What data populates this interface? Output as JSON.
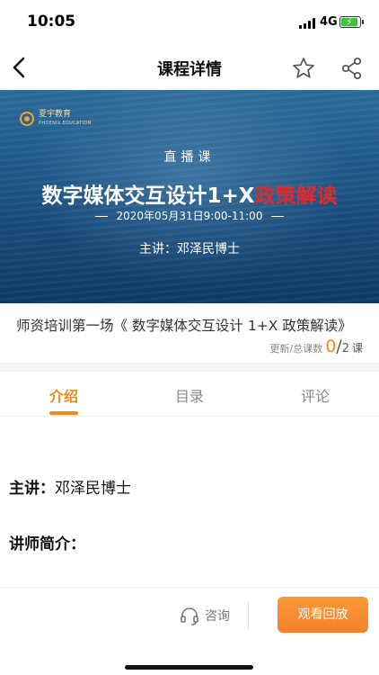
{
  "status_bar": {
    "time": "10:05",
    "network": "4G",
    "battery_level": 0.8
  },
  "nav": {
    "title": "课程详情",
    "icons": [
      "back-arrow-icon",
      "star-outline-icon",
      "share-icon"
    ]
  },
  "banner": {
    "brand_name": "夏宇教育",
    "brand_sub": "PHOENIX EDUCATION",
    "live_tag": "直播课",
    "headline_main": "数字媒体交互设计1+X",
    "headline_highlight": "政策解读",
    "date_time": "2020年05月31日9:00-11:00",
    "speaker": "主讲：邓泽民博士",
    "colors": {
      "highlight": "#e3282b",
      "brand": "#f0a030"
    }
  },
  "course": {
    "title": "师资培训第一场《 数字媒体交互设计 1+X 政策解读》",
    "count_label": "更新/总课数",
    "updated": "0",
    "separator": "/",
    "total": "2",
    "unit": "课"
  },
  "tabs": {
    "items": [
      {
        "label": "介绍",
        "active": true
      },
      {
        "label": "目录",
        "active": false
      },
      {
        "label": "评论",
        "active": false
      }
    ],
    "accent": "#f28a1c"
  },
  "intro": {
    "speaker_label": "主讲：",
    "speaker_name": "邓泽民博士",
    "bio_label": "讲师简介："
  },
  "bottom": {
    "consult_label": "咨询",
    "watch_label": "观看回放",
    "icons": [
      "headset-icon"
    ]
  }
}
